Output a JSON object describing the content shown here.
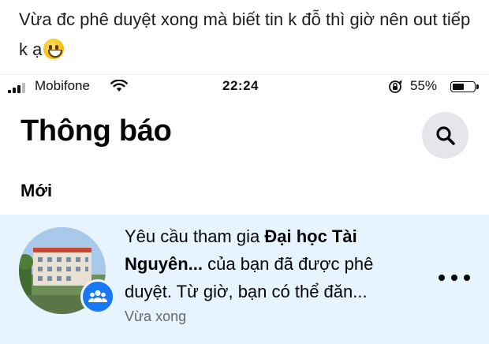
{
  "caption": {
    "text": "Vừa đc phê duyệt xong mà biết tin k đỗ thì giờ nên out tiếp k ạ",
    "emoji": "grinning-face-emoji"
  },
  "status_bar": {
    "carrier": "Mobifone",
    "time": "22:24",
    "battery_percent": "55%",
    "battery_level": 0.55,
    "icons": [
      "signal-icon",
      "wifi-icon",
      "orientation-lock-icon",
      "battery-icon"
    ]
  },
  "header": {
    "title": "Thông báo",
    "search_icon": "search-icon"
  },
  "section": {
    "label": "Mới"
  },
  "notification": {
    "text_prefix": "Yêu cầu tham gia ",
    "group_name": "Đại học Tài Nguyên...",
    "text_suffix": " của bạn đã được phê duyệt. Từ giờ, bạn có thể đăn...",
    "time": "Vừa xong",
    "badge_icon": "group-icon",
    "more_icon": "more-options-icon",
    "background": "#e7f3ff"
  },
  "colors": {
    "accent": "#1877f2",
    "secondary_text": "#65676b",
    "button_bg": "#e4e6eb"
  }
}
